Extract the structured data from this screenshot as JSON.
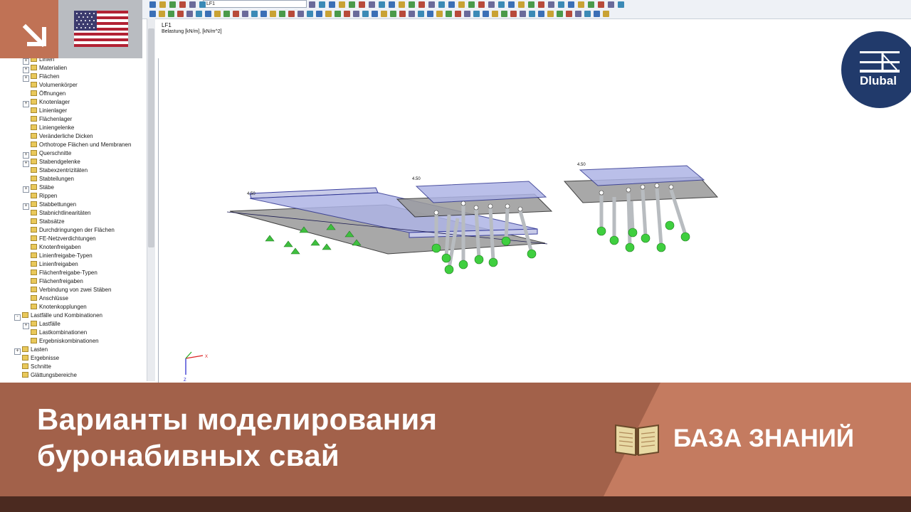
{
  "toolbar": {
    "load_case_combo": "LF1"
  },
  "tree": {
    "items": [
      {
        "label": "Linien",
        "level": 1,
        "expander": "+"
      },
      {
        "label": "Materialien",
        "level": 1,
        "expander": "+"
      },
      {
        "label": "Flächen",
        "level": 1,
        "expander": "+"
      },
      {
        "label": "Volumenkörper",
        "level": 1,
        "expander": ""
      },
      {
        "label": "Öffnungen",
        "level": 1,
        "expander": ""
      },
      {
        "label": "Knotenlager",
        "level": 1,
        "expander": "+"
      },
      {
        "label": "Linienlager",
        "level": 1,
        "expander": ""
      },
      {
        "label": "Flächenlager",
        "level": 1,
        "expander": ""
      },
      {
        "label": "Liniengelenke",
        "level": 1,
        "expander": ""
      },
      {
        "label": "Veränderliche Dicken",
        "level": 1,
        "expander": ""
      },
      {
        "label": "Orthotrope Flächen und Membranen",
        "level": 1,
        "expander": ""
      },
      {
        "label": "Querschnitte",
        "level": 1,
        "expander": "+"
      },
      {
        "label": "Stabendgelenke",
        "level": 1,
        "expander": "+"
      },
      {
        "label": "Stabexzentrizitäten",
        "level": 1,
        "expander": ""
      },
      {
        "label": "Stabteilungen",
        "level": 1,
        "expander": ""
      },
      {
        "label": "Stäbe",
        "level": 1,
        "expander": "+"
      },
      {
        "label": "Rippen",
        "level": 1,
        "expander": ""
      },
      {
        "label": "Stabbettungen",
        "level": 1,
        "expander": "+"
      },
      {
        "label": "Stabnichtlinearitäten",
        "level": 1,
        "expander": ""
      },
      {
        "label": "Stabsätze",
        "level": 1,
        "expander": ""
      },
      {
        "label": "Durchdringungen der Flächen",
        "level": 1,
        "expander": ""
      },
      {
        "label": "FE-Netzverdichtungen",
        "level": 1,
        "expander": ""
      },
      {
        "label": "Knotenfreigaben",
        "level": 1,
        "expander": ""
      },
      {
        "label": "Linienfreigabe-Typen",
        "level": 1,
        "expander": ""
      },
      {
        "label": "Linienfreigaben",
        "level": 1,
        "expander": ""
      },
      {
        "label": "Flächenfreigabe-Typen",
        "level": 1,
        "expander": ""
      },
      {
        "label": "Flächenfreigaben",
        "level": 1,
        "expander": ""
      },
      {
        "label": "Verbindung von zwei Stäben",
        "level": 1,
        "expander": ""
      },
      {
        "label": "Anschlüsse",
        "level": 1,
        "expander": ""
      },
      {
        "label": "Knotenkopplungen",
        "level": 1,
        "expander": ""
      },
      {
        "label": "Lastfälle und Kombinationen",
        "level": 0,
        "expander": "-"
      },
      {
        "label": "Lastfälle",
        "level": 1,
        "expander": "+"
      },
      {
        "label": "Lastkombinationen",
        "level": 1,
        "expander": ""
      },
      {
        "label": "Ergebniskombinationen",
        "level": 1,
        "expander": ""
      },
      {
        "label": "Lasten",
        "level": 0,
        "expander": "+"
      },
      {
        "label": "Ergebnisse",
        "level": 0,
        "expander": ""
      },
      {
        "label": "Schnitte",
        "level": 0,
        "expander": ""
      },
      {
        "label": "Glättungsbereiche",
        "level": 0,
        "expander": ""
      }
    ]
  },
  "viewport": {
    "title": "LF1",
    "subtitle": "Belastung [kN/m], [kN/m^2]",
    "model_labels": [
      "4.50",
      "4.50",
      "4.50"
    ],
    "axis_x": "X",
    "axis_z": "Z"
  },
  "logo": {
    "text": "Dlubal",
    "color": "#213a6b"
  },
  "banner": {
    "headline_line1": "Варианты моделирования",
    "headline_line2": "буронабивных свай",
    "kb_label": "БАЗА ЗНАНИЙ",
    "color_left": "#a2614a",
    "color_right": "#c47b60"
  }
}
